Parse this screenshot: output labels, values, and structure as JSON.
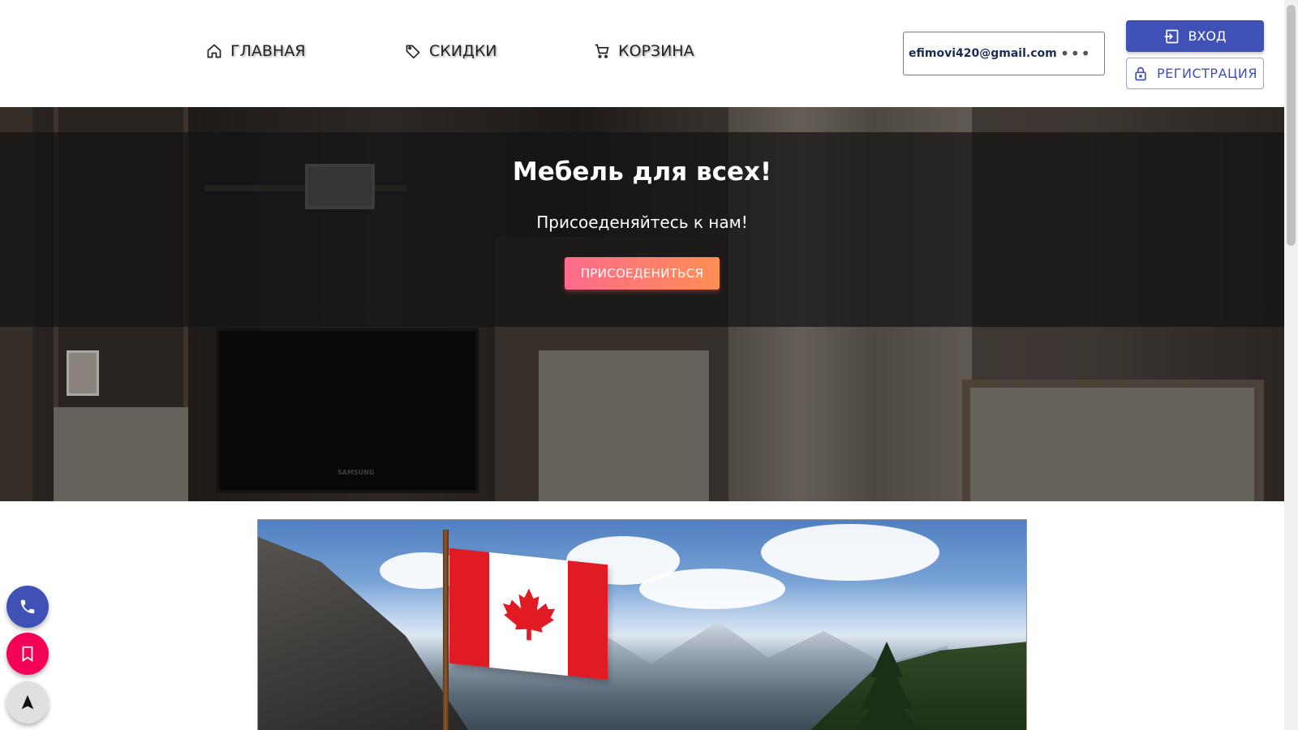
{
  "nav": {
    "items": [
      {
        "label": "ГЛАВНАЯ",
        "icon": "home-icon"
      },
      {
        "label": "СКИДКИ",
        "icon": "tag-icon"
      },
      {
        "label": "КОРЗИНА",
        "icon": "cart-icon"
      }
    ]
  },
  "account": {
    "email": "efimovi420@gmail.com",
    "more_icon": "more-horizontal-icon",
    "login_label": "ВХОД",
    "register_label": "РЕГИСТРАЦИЯ"
  },
  "hero": {
    "title": "Мебель для всех!",
    "subtitle": "Присоеденяйтесь к нам!",
    "button_label": "ПРИСОЕДЕНИТЬСЯ",
    "tv_brand": "SAMSUNG"
  },
  "banner": {
    "subject": "canada-flag-mountains-image"
  },
  "fabs": [
    {
      "icon": "phone-icon",
      "color": "#3f51b5"
    },
    {
      "icon": "bookmark-icon",
      "color": "#f50057"
    },
    {
      "icon": "navigation-arrow-icon",
      "color": "#e0e0e0"
    }
  ],
  "colors": {
    "primary": "#3f51b5",
    "accent_gradient_start": "#fe6b8b",
    "accent_gradient_end": "#ff8e53",
    "secondary": "#f50057"
  }
}
